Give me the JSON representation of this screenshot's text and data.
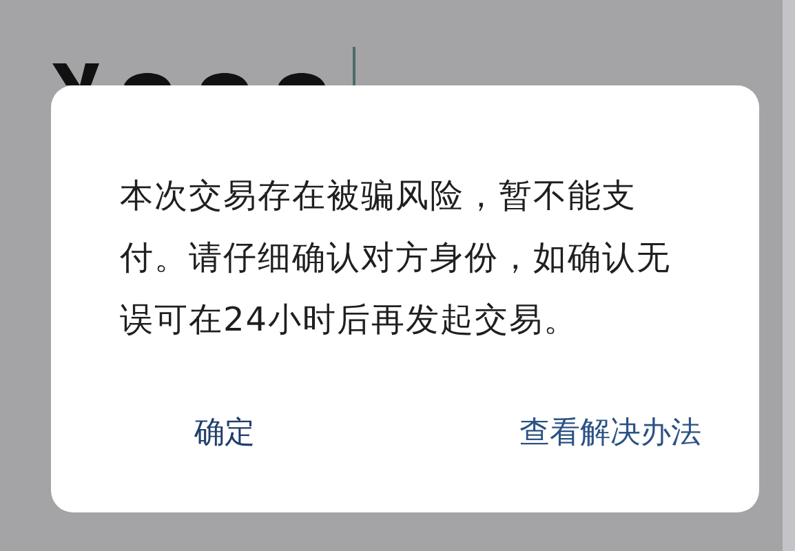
{
  "dialog": {
    "message": "本次交易存在被骗风险，暂不能支付。请仔细确认对方身份，如确认无误可在24小时后再发起交易。",
    "buttons": [
      {
        "label": "确定",
        "kind": "secondary"
      },
      {
        "label": "查看解决办法",
        "kind": "primary"
      }
    ]
  }
}
